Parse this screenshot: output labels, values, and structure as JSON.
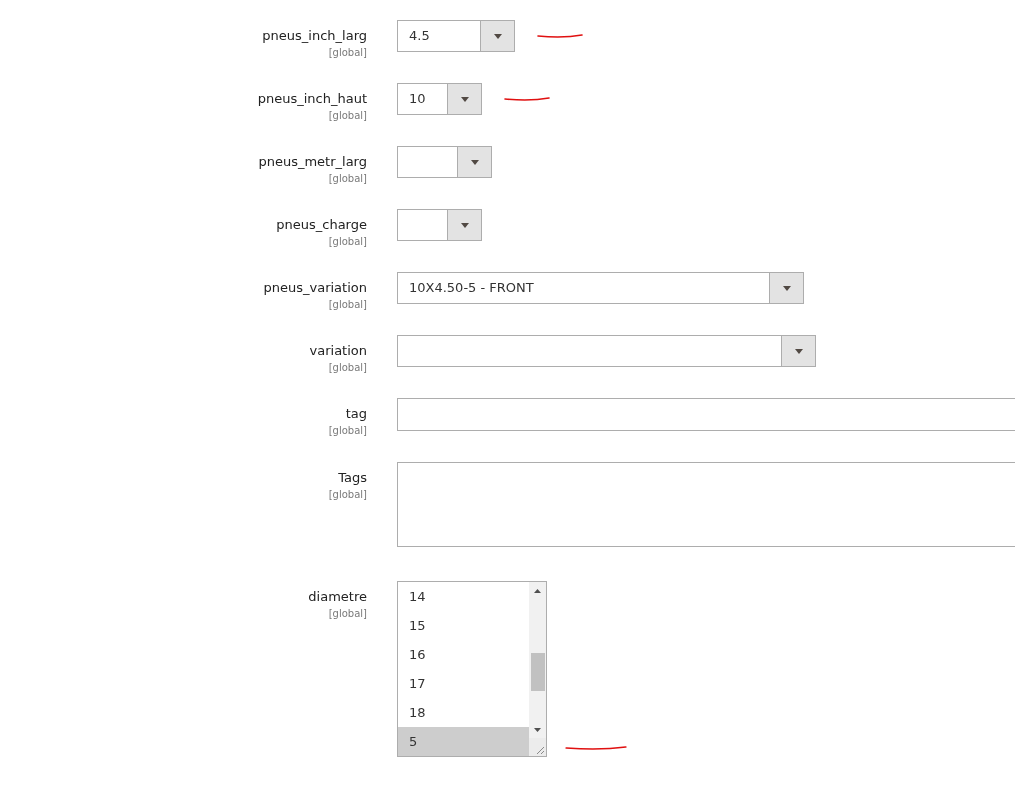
{
  "fields": [
    {
      "kind": "select",
      "label": "pneus_inch_larg",
      "scope": "[global]",
      "value": "4.5",
      "marked": true
    },
    {
      "kind": "select",
      "label": "pneus_inch_haut",
      "scope": "[global]",
      "value": "10",
      "marked": true
    },
    {
      "kind": "select",
      "label": "pneus_metr_larg",
      "scope": "[global]",
      "marked": false
    },
    {
      "kind": "select",
      "label": "pneus_charge",
      "scope": "[global]",
      "marked": false
    },
    {
      "kind": "select",
      "label": "pneus_variation",
      "scope": "[global]",
      "value": "10X4.50-5 - FRONT",
      "marked": false
    },
    {
      "kind": "select",
      "label": "variation",
      "scope": "[global]",
      "marked": false
    },
    {
      "kind": "text",
      "label": "tag",
      "scope": "[global]",
      "marked": false
    },
    {
      "kind": "textarea",
      "label": "Tags",
      "scope": "[global]",
      "marked": false
    },
    {
      "kind": "multiselect",
      "label": "diametre",
      "scope": "[global]",
      "marked": true,
      "options": [
        {
          "label": "14",
          "selected": false
        },
        {
          "label": "15",
          "selected": false
        },
        {
          "label": "16",
          "selected": false
        },
        {
          "label": "17",
          "selected": false
        },
        {
          "label": "18",
          "selected": false
        },
        {
          "label": "5",
          "selected": true
        }
      ]
    }
  ]
}
